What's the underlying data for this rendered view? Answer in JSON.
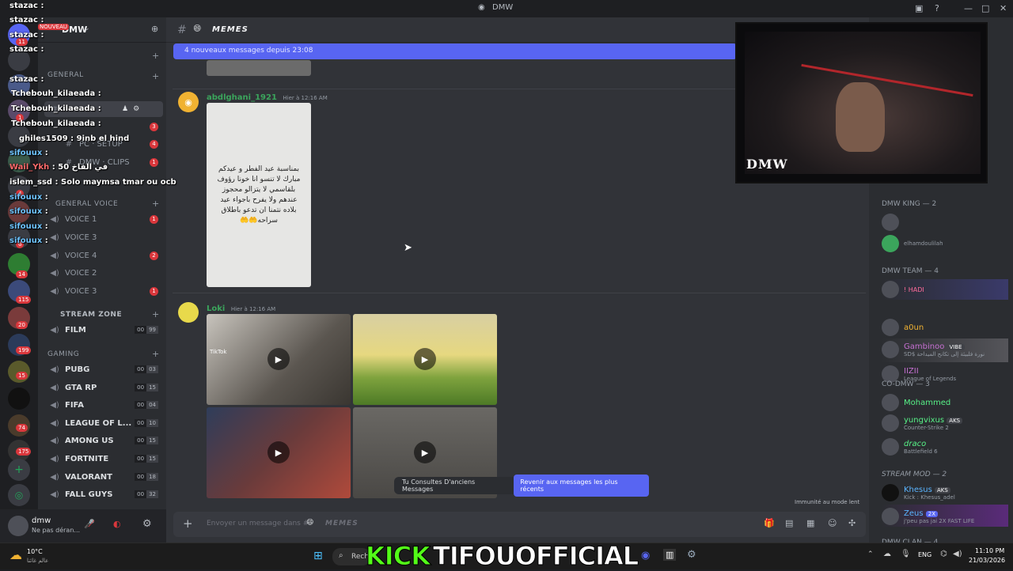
{
  "window": {
    "title": "DMW"
  },
  "server": {
    "name": "DMW",
    "new_badge": "NOUVEAU"
  },
  "server_badges": [
    "11",
    "1",
    "4",
    "6",
    "14",
    "115",
    "20",
    "199",
    "15",
    "74",
    "175"
  ],
  "channels": {
    "cat_general": "GENERAL",
    "row_setup": "PC · SETUP",
    "row_setup_badge": "4",
    "row_clips": "DMW · CLIPS",
    "row_clips_badge": "1",
    "row_memes_badge": "3",
    "cat_general_voice": "GENERAL VOICE",
    "voice": [
      {
        "name": "VOICE 1",
        "badge": "1"
      },
      {
        "name": "VOICE 3",
        "badge": ""
      },
      {
        "name": "VOICE 4",
        "badge": "2"
      },
      {
        "name": "VOICE 2",
        "badge": ""
      },
      {
        "name": "VOICE 3",
        "badge": "1"
      }
    ],
    "cat_stream_zone": "STREAM ZONE",
    "film": {
      "name": "FILM",
      "a": "00",
      "b": "99"
    },
    "cat_gaming": "GAMING",
    "gaming": [
      {
        "name": "PUBG",
        "a": "00",
        "b": "03"
      },
      {
        "name": "GTA RP",
        "a": "00",
        "b": "15"
      },
      {
        "name": "FIFA",
        "a": "00",
        "b": "04"
      },
      {
        "name": "LEAGUE OF L...",
        "a": "00",
        "b": "10"
      },
      {
        "name": "AMONG US",
        "a": "00",
        "b": "15"
      },
      {
        "name": "FORTNITE",
        "a": "00",
        "b": "15"
      },
      {
        "name": "VALORANT",
        "a": "00",
        "b": "18"
      },
      {
        "name": "FALL GUYS",
        "a": "00",
        "b": "32"
      }
    ]
  },
  "user": {
    "name": "dmw",
    "status": "Ne pas déran..."
  },
  "chat": {
    "channel_name": "MEMES",
    "new_messages": "4 nouveaux messages depuis 23:08",
    "msg1_author": "abdlghani_1921",
    "msg1_time": "Hier à 12:16 AM",
    "msg1_image_text": "بمناسبة عيد الفطر و عيدكم مبارك لا تنسو انا خونا رؤوف بلقاسمي لا يتزالو محجوز عندهم ولا يفرح باجواء عيد بلاده نتمنا ان تدعو باطلاق سراحه🤲🤲",
    "msg2_author": "Loki",
    "msg2_time": "Hier à 12:16 AM",
    "tiktok_label": "TikTok",
    "jump_text": "Tu Consultes D'anciens Messages",
    "jump_button": "Revenir aux messages les plus récents",
    "slowmode": "Immunité au mode lent",
    "composer_placeholder": "Envoyer un message dans #",
    "composer_channel": "MEMES"
  },
  "members": {
    "groups": [
      {
        "title": "DMW KING — 2"
      },
      {
        "title": "DMW TEAM — 4"
      },
      {
        "title": "CO-DMW — 3"
      },
      {
        "title": "STREAM MOD — 2"
      },
      {
        "title": "DMW CLAN — 4"
      }
    ],
    "list": [
      {
        "name": "",
        "sub": ""
      },
      {
        "name": "",
        "sub": "elhamdoulilah"
      },
      {
        "name": "! HADI",
        "sub": ""
      },
      {
        "name": "a0un",
        "sub": ""
      },
      {
        "name": "Gambinoo",
        "sub": "SD$ نورة فلبيئة إلى تكانح الميداحة",
        "tag": "VIBE"
      },
      {
        "name": "IIZII",
        "sub": "League of Legends"
      },
      {
        "name": "Mohammed",
        "sub": ""
      },
      {
        "name": "yungvixus",
        "sub": "Counter-Strike 2",
        "tag": "AKS"
      },
      {
        "name": "draco",
        "sub": "Battlefield 6"
      },
      {
        "name": "Khesus",
        "sub": "Kick : Khesus_adel",
        "tag": "AKS"
      },
      {
        "name": "Zeus",
        "sub": "j'peu pas jai 2X FAST LIFE",
        "tag": "2X"
      }
    ]
  },
  "webcam": {
    "logo": "DMW"
  },
  "overlay": [
    {
      "name": "stazac",
      "text": ""
    },
    {
      "name": "stazac",
      "text": ""
    },
    {
      "name": "stazac",
      "text": ""
    },
    {
      "name": "stazac",
      "text": ""
    },
    {
      "name": "stazac",
      "text": ""
    },
    {
      "name": "Tchebouh_kilaeada",
      "text": ""
    },
    {
      "name": "Tchebouh_kilaeada",
      "text": ""
    },
    {
      "name": "Tchebouh_kilaeada",
      "text": ""
    },
    {
      "name": "ghiles1509",
      "text": "9inb el hind"
    },
    {
      "name": "sifouux",
      "text": ""
    },
    {
      "name": "Wail_Ykh",
      "text": "50 في الفاخ"
    },
    {
      "name": "islem_ssd",
      "text": "Solo maymsa tmar ou ocb"
    },
    {
      "name": "sifouux",
      "text": ""
    },
    {
      "name": "sifouux",
      "text": ""
    },
    {
      "name": "sifouux",
      "text": ""
    },
    {
      "name": "sifouux",
      "text": ""
    }
  ],
  "kick": {
    "prefix": "KICK",
    "channel": "TIFOUOFFICIAL"
  },
  "taskbar": {
    "weather_temp": "10°C",
    "weather_desc": "عالم غائنا",
    "search": "Rech",
    "lang": "ENG",
    "time": "11:10 PM",
    "date": "21/03/2026"
  },
  "colors": {
    "accent": "#5865f2",
    "kick": "#53fc18",
    "danger": "#da373c"
  }
}
